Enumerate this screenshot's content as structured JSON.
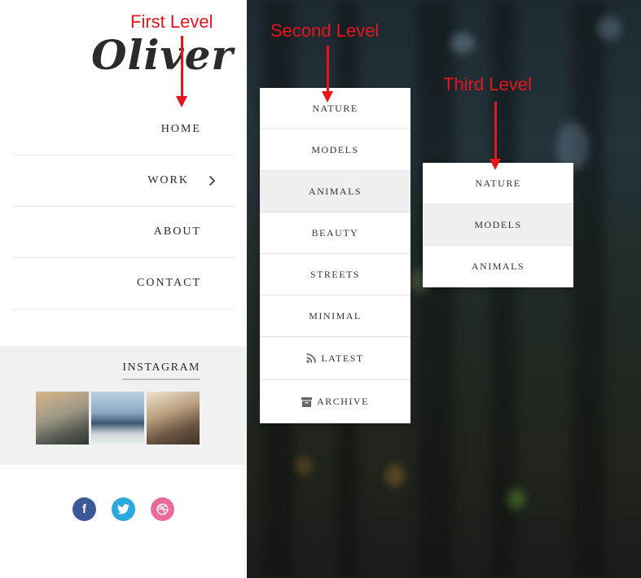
{
  "site": {
    "logo_text": "Oliver"
  },
  "nav": {
    "items": [
      {
        "label": "HOME"
      },
      {
        "label": "WORK",
        "has_submenu": true
      },
      {
        "label": "ABOUT"
      },
      {
        "label": "CONTACT"
      }
    ]
  },
  "instagram": {
    "title": "INSTAGRAM"
  },
  "social": {
    "facebook": "f",
    "twitter": "twitter-icon",
    "dribbble": "dribbble-icon"
  },
  "submenu_level2": {
    "items": [
      {
        "label": "NATURE"
      },
      {
        "label": "MODELS"
      },
      {
        "label": "ANIMALS",
        "active": true
      },
      {
        "label": "BEAUTY"
      },
      {
        "label": "STREETS"
      },
      {
        "label": "MINIMAL"
      },
      {
        "label": "LATEST",
        "icon": "rss-icon"
      },
      {
        "label": "ARCHIVE",
        "icon": "archive-icon"
      }
    ]
  },
  "submenu_level3": {
    "items": [
      {
        "label": "NATURE"
      },
      {
        "label": "MODELS",
        "active": true
      },
      {
        "label": "ANIMALS"
      }
    ]
  },
  "annotations": {
    "first_level": "First Level",
    "second_level": "Second Level",
    "third_level": "Third Level",
    "color": "#e8141b"
  },
  "colors": {
    "facebook": "#3b5998",
    "twitter": "#2ba8df",
    "dribbble": "#ea6b9b"
  }
}
